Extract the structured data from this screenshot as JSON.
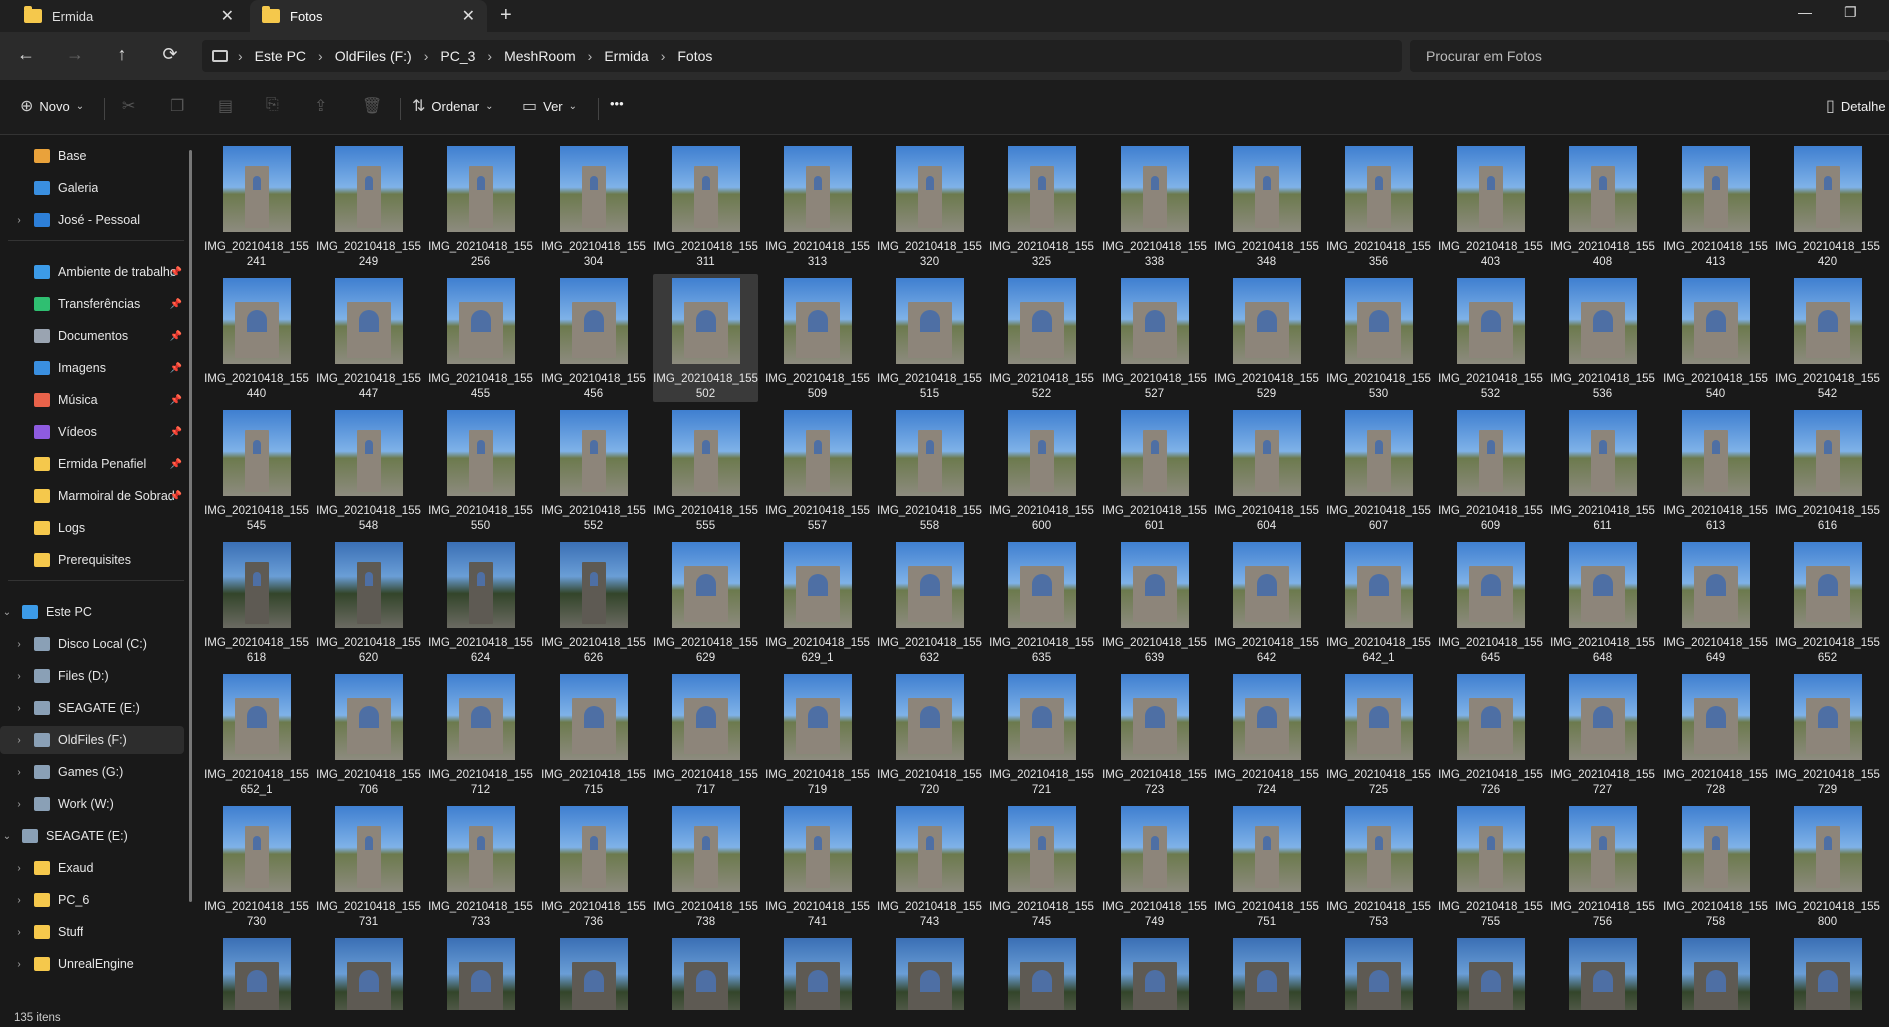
{
  "tabs": [
    {
      "title": "Ermida",
      "icon": "folder-icon"
    },
    {
      "title": "Fotos",
      "icon": "folder-icon"
    }
  ],
  "new_tab": "+",
  "window_controls": {
    "minimize": "—",
    "maximize": "❐"
  },
  "nav": {
    "back": "←",
    "forward": "→",
    "up": "↑",
    "refresh": "⟳"
  },
  "breadcrumb": [
    "Este PC",
    "OldFiles (F:)",
    "PC_3",
    "MeshRoom",
    "Ermida",
    "Fotos"
  ],
  "search": {
    "placeholder": "Procurar em Fotos"
  },
  "toolbar": {
    "new_label": "Novo",
    "sort_label": "Ordenar",
    "view_label": "Ver",
    "more_label": "•••",
    "details_label": "Detalhe"
  },
  "sidebar": {
    "quick": [
      {
        "label": "Base",
        "icon": "home-icon",
        "color": "#e9a23b"
      },
      {
        "label": "Galeria",
        "icon": "gallery-icon",
        "color": "#3a8fe0"
      },
      {
        "label": "José - Pessoal",
        "icon": "cloud-icon",
        "color": "#2d7fd8"
      }
    ],
    "pinned": [
      {
        "label": "Ambiente de trabalho",
        "icon": "desktop-icon",
        "color": "#3c9be8"
      },
      {
        "label": "Transferências",
        "icon": "download-icon",
        "color": "#2fbf71"
      },
      {
        "label": "Documentos",
        "icon": "document-icon",
        "color": "#9aa4b1"
      },
      {
        "label": "Imagens",
        "icon": "image-icon",
        "color": "#3a8fe0"
      },
      {
        "label": "Música",
        "icon": "music-icon",
        "color": "#e8624a"
      },
      {
        "label": "Vídeos",
        "icon": "video-icon",
        "color": "#8e5be0"
      },
      {
        "label": "Ermida Penafiel",
        "icon": "folder-icon",
        "color": "#f5c84c"
      },
      {
        "label": "Marmoiral de Sobrado",
        "icon": "folder-icon",
        "color": "#f5c84c"
      },
      {
        "label": "Logs",
        "icon": "folder-icon",
        "color": "#f5c84c"
      },
      {
        "label": "Prerequisites",
        "icon": "folder-icon",
        "color": "#f5c84c"
      }
    ],
    "este_pc": {
      "label": "Este PC",
      "icon": "pc-icon",
      "color": "#3c9be8"
    },
    "drives": [
      {
        "label": "Disco Local (C:)",
        "icon": "drive-icon",
        "color": "#8aa0b6"
      },
      {
        "label": "Files (D:)",
        "icon": "drive-icon",
        "color": "#8aa0b6"
      },
      {
        "label": "SEAGATE (E:)",
        "icon": "drive-icon",
        "color": "#8aa0b6"
      },
      {
        "label": "OldFiles (F:)",
        "icon": "drive-icon",
        "color": "#8aa0b6"
      },
      {
        "label": "Games (G:)",
        "icon": "drive-icon",
        "color": "#8aa0b6"
      },
      {
        "label": "Work (W:)",
        "icon": "drive-icon",
        "color": "#8aa0b6"
      }
    ],
    "seagate": {
      "label": "SEAGATE (E:)",
      "icon": "drive-icon",
      "color": "#8aa0b6"
    },
    "seagate_folders": [
      {
        "label": "Exaud",
        "icon": "folder-icon",
        "color": "#f5c84c"
      },
      {
        "label": "PC_6",
        "icon": "folder-icon",
        "color": "#f5c84c"
      },
      {
        "label": "Stuff",
        "icon": "folder-icon",
        "color": "#f5c84c"
      },
      {
        "label": "UnrealEngine",
        "icon": "folder-icon",
        "color": "#f5c84c"
      }
    ]
  },
  "files": [
    [
      "IMG_20210418_155241",
      "IMG_20210418_155249",
      "IMG_20210418_155256",
      "IMG_20210418_155304",
      "IMG_20210418_155311",
      "IMG_20210418_155313",
      "IMG_20210418_155320",
      "IMG_20210418_155325",
      "IMG_20210418_155338",
      "IMG_20210418_155348",
      "IMG_20210418_155356",
      "IMG_20210418_155403",
      "IMG_20210418_155408",
      "IMG_20210418_155413",
      "IMG_20210418_155420"
    ],
    [
      "IMG_20210418_155440",
      "IMG_20210418_155447",
      "IMG_20210418_155455",
      "IMG_20210418_155456",
      "IMG_20210418_155502",
      "IMG_20210418_155509",
      "IMG_20210418_155515",
      "IMG_20210418_155522",
      "IMG_20210418_155527",
      "IMG_20210418_155529",
      "IMG_20210418_155530",
      "IMG_20210418_155532",
      "IMG_20210418_155536",
      "IMG_20210418_155540",
      "IMG_20210418_155542"
    ],
    [
      "IMG_20210418_155545",
      "IMG_20210418_155548",
      "IMG_20210418_155550",
      "IMG_20210418_155552",
      "IMG_20210418_155555",
      "IMG_20210418_155557",
      "IMG_20210418_155558",
      "IMG_20210418_155600",
      "IMG_20210418_155601",
      "IMG_20210418_155604",
      "IMG_20210418_155607",
      "IMG_20210418_155609",
      "IMG_20210418_155611",
      "IMG_20210418_155613",
      "IMG_20210418_155616"
    ],
    [
      "IMG_20210418_155618",
      "IMG_20210418_155620",
      "IMG_20210418_155624",
      "IMG_20210418_155626",
      "IMG_20210418_155629",
      "IMG_20210418_155629_1",
      "IMG_20210418_155632",
      "IMG_20210418_155635",
      "IMG_20210418_155639",
      "IMG_20210418_155642",
      "IMG_20210418_155642_1",
      "IMG_20210418_155645",
      "IMG_20210418_155648",
      "IMG_20210418_155649",
      "IMG_20210418_155652"
    ],
    [
      "IMG_20210418_155652_1",
      "IMG_20210418_155706",
      "IMG_20210418_155712",
      "IMG_20210418_155715",
      "IMG_20210418_155717",
      "IMG_20210418_155719",
      "IMG_20210418_155720",
      "IMG_20210418_155721",
      "IMG_20210418_155723",
      "IMG_20210418_155724",
      "IMG_20210418_155725",
      "IMG_20210418_155726",
      "IMG_20210418_155727",
      "IMG_20210418_155728",
      "IMG_20210418_155729"
    ],
    [
      "IMG_20210418_155730",
      "IMG_20210418_155731",
      "IMG_20210418_155733",
      "IMG_20210418_155736",
      "IMG_20210418_155738",
      "IMG_20210418_155741",
      "IMG_20210418_155743",
      "IMG_20210418_155745",
      "IMG_20210418_155749",
      "IMG_20210418_155751",
      "IMG_20210418_155753",
      "IMG_20210418_155755",
      "IMG_20210418_155756",
      "IMG_20210418_155758",
      "IMG_20210418_155800"
    ],
    [
      "",
      "",
      "",
      "",
      "",
      "",
      "",
      "",
      "",
      "",
      "",
      "",
      "",
      "",
      ""
    ]
  ],
  "selected_file": "IMG_20210418_155502",
  "status": {
    "item_count": "135 itens"
  }
}
